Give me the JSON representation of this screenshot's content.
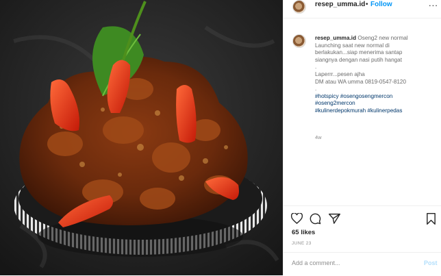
{
  "post": {
    "image_alt": "Oseng mercon beef dish with red chilies in striped bowl"
  },
  "header": {
    "username": "resep_umma.id",
    "separator": "•",
    "follow_label": "Follow",
    "more_label": "..."
  },
  "caption": {
    "username": "resep_umma.id",
    "lines": [
      "Oseng2 new normal",
      "Launching saat new normal di",
      "berlakukan...siap menerima santap",
      "siangnya dengan nasi putih hangat",
      ".",
      "Laperrr...pesen ajha",
      "DM atau WA umma 0819-0547-8120",
      "."
    ],
    "hashtags": [
      "#hotspicy #osengosengmercon",
      "#oseng2mercon",
      "#kulinerdepokmurah #kulinerpedas"
    ],
    "time_ago": "4w"
  },
  "actions": {
    "likes": "65 likes",
    "date": "JUNE 23",
    "icons": [
      "heart-icon",
      "comment-icon",
      "share-icon",
      "bookmark-icon"
    ]
  },
  "comment": {
    "placeholder": "Add a comment...",
    "post_label": "Post"
  },
  "colors": {
    "link_blue": "#0095f6",
    "hashtag_blue": "#00376b",
    "post_disabled": "#b2dffc"
  }
}
